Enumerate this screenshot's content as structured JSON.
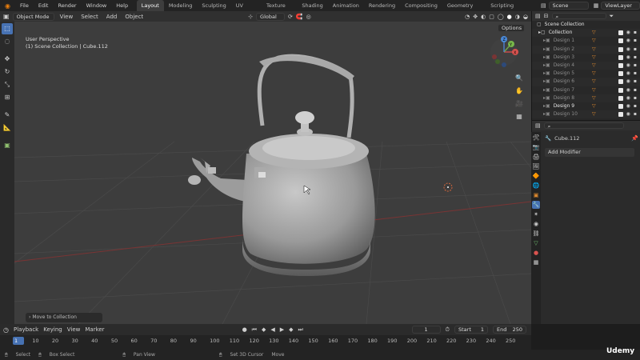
{
  "topbar": {
    "menus": [
      "File",
      "Edit",
      "Render",
      "Window",
      "Help"
    ],
    "workspaces": [
      "Layout",
      "Modeling",
      "Sculpting",
      "UV Editing",
      "Texture Paint",
      "Shading",
      "Animation",
      "Rendering",
      "Compositing",
      "Geometry Nodes",
      "Scripting"
    ],
    "active_workspace": "Layout",
    "scene": "Scene",
    "view_layer": "ViewLayer"
  },
  "viewport_header": {
    "mode": "Object Mode",
    "menus": [
      "View",
      "Select",
      "Add",
      "Object"
    ],
    "orientation": "Global",
    "options_label": "Options"
  },
  "viewport": {
    "perspective_label": "User Perspective",
    "collection_label": "(1) Scene Collection | Cube.112",
    "operator_panel": "Move to Collection",
    "gizmo": {
      "x": "X",
      "y": "Y",
      "z": "Z"
    }
  },
  "outliner": {
    "root": "Scene Collection",
    "items": [
      {
        "label": "Collection",
        "hi": true
      },
      {
        "label": "Design 1",
        "hi": false
      },
      {
        "label": "Design 2",
        "hi": false
      },
      {
        "label": "Design 3",
        "hi": false
      },
      {
        "label": "Design 4",
        "hi": false
      },
      {
        "label": "Design 5",
        "hi": false
      },
      {
        "label": "Design 6",
        "hi": false
      },
      {
        "label": "Design 7",
        "hi": false
      },
      {
        "label": "Design 8",
        "hi": false
      },
      {
        "label": "Design 9",
        "hi": true
      },
      {
        "label": "Design 10",
        "hi": false
      }
    ]
  },
  "properties": {
    "object_name": "Cube.112",
    "add_modifier": "Add Modifier"
  },
  "timeline": {
    "menus": [
      "Playback",
      "Keying",
      "View",
      "Marker"
    ],
    "current_frame": "1",
    "start_label": "Start",
    "start_value": "1",
    "end_label": "End",
    "end_value": "250",
    "ruler_ticks": [
      "1",
      "10",
      "20",
      "30",
      "40",
      "50",
      "60",
      "70",
      "80",
      "90",
      "100",
      "110",
      "120",
      "130",
      "140",
      "150",
      "160",
      "170",
      "180",
      "190",
      "200",
      "210",
      "220",
      "230",
      "240",
      "250"
    ]
  },
  "statusbar": {
    "items": [
      "Select",
      "Box Select",
      "Pan View",
      "Set 3D Cursor",
      "Move"
    ]
  },
  "watermark": "Udemy",
  "colors": {
    "accent": "#4772b3",
    "object_orange": "#e08a2e",
    "grid_red": "#8a3a3a"
  }
}
